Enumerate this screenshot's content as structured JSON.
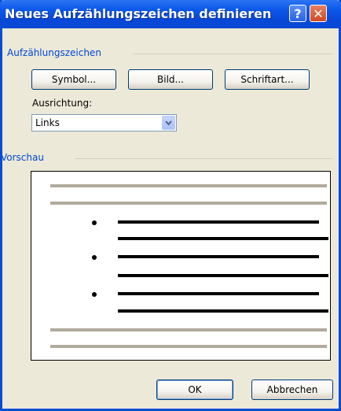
{
  "window": {
    "title": "Neues Aufzählungszeichen definieren",
    "help_glyph": "?",
    "close_glyph": "✕"
  },
  "groups": {
    "bullet_char": "Aufzählungszeichen",
    "preview": "Vorschau"
  },
  "buttons": {
    "symbol_label": "Symbol...",
    "image_label": "Bild...",
    "font_label": "Schriftart...",
    "ok_label": "OK",
    "cancel_label": "Abbrechen"
  },
  "alignment": {
    "label": "Ausrichtung:",
    "value": "Links"
  },
  "colors": {
    "title_blue": "#0b57e8",
    "group_label": "#0046d5",
    "dialog_bg": "#ece9d8"
  }
}
